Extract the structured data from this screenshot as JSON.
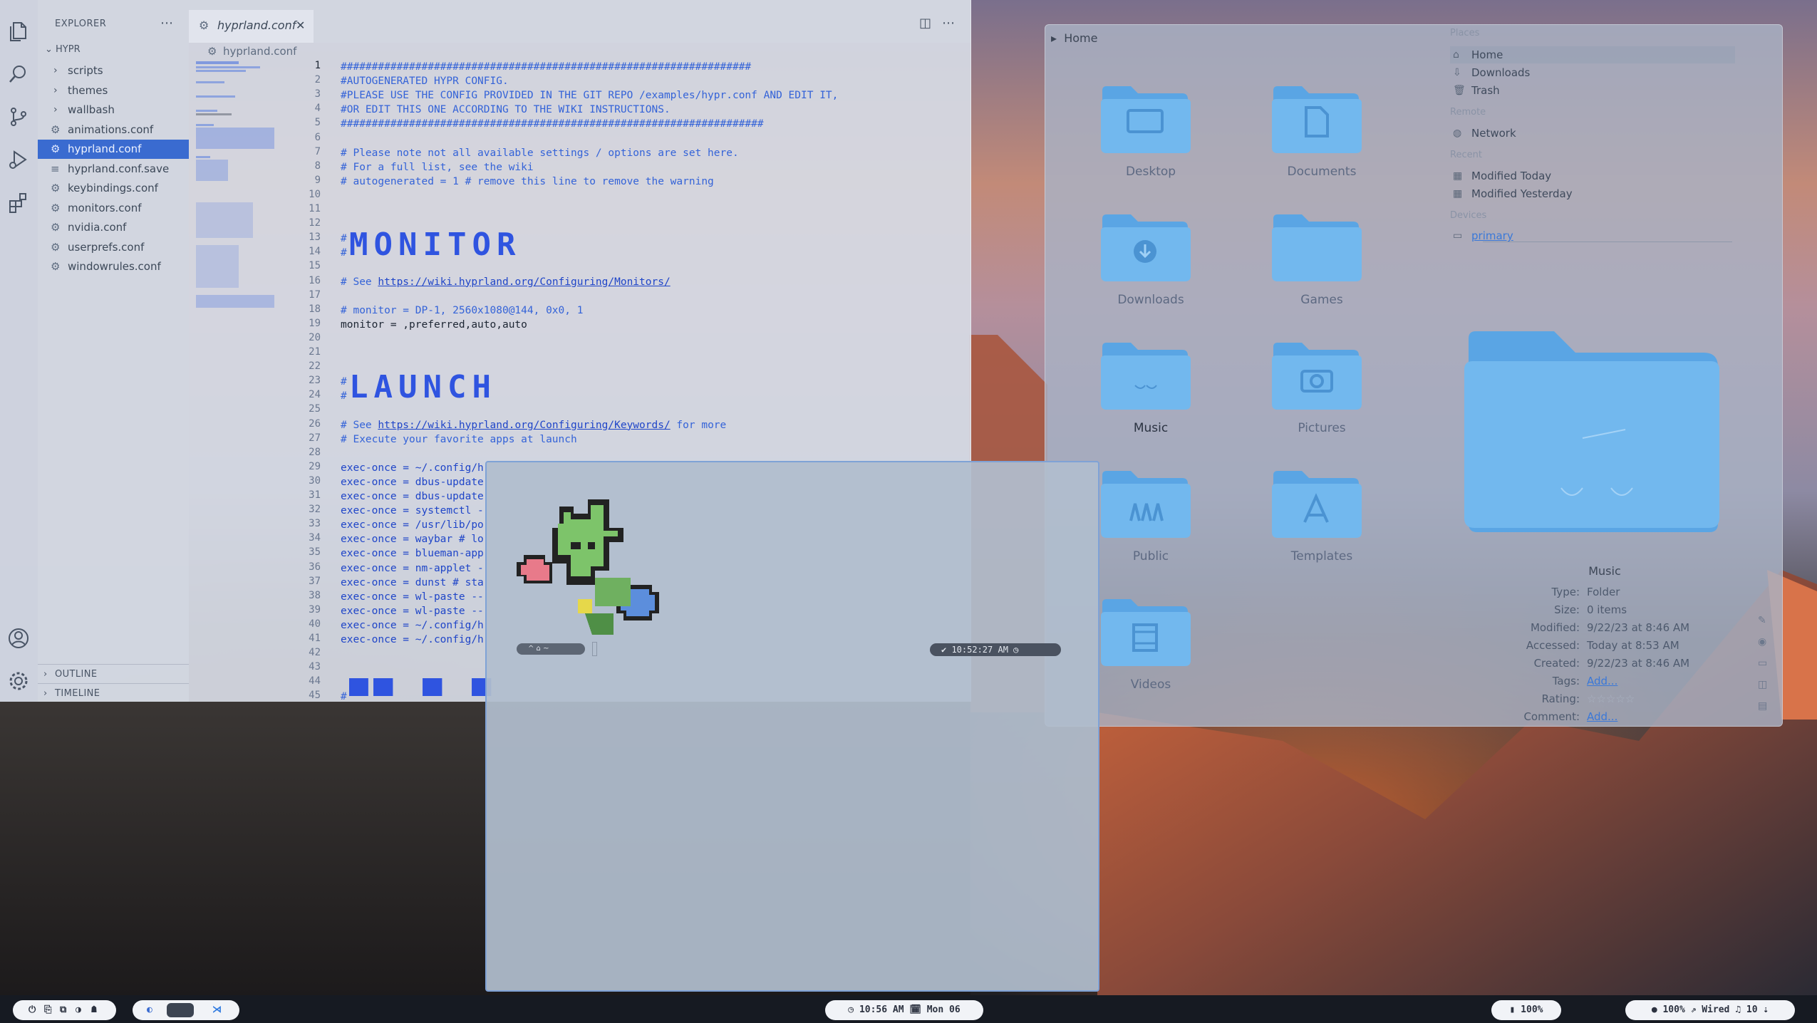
{
  "vscode": {
    "explorer_title": "EXPLORER",
    "root": "HYPR",
    "tree": [
      {
        "label": "scripts",
        "type": "folder"
      },
      {
        "label": "themes",
        "type": "folder"
      },
      {
        "label": "wallbash",
        "type": "folder"
      },
      {
        "label": "animations.conf",
        "type": "file"
      },
      {
        "label": "hyprland.conf",
        "type": "file",
        "selected": true
      },
      {
        "label": "hyprland.conf.save",
        "type": "file"
      },
      {
        "label": "keybindings.conf",
        "type": "file"
      },
      {
        "label": "monitors.conf",
        "type": "file"
      },
      {
        "label": "nvidia.conf",
        "type": "file"
      },
      {
        "label": "userprefs.conf",
        "type": "file"
      },
      {
        "label": "windowrules.conf",
        "type": "file"
      }
    ],
    "outline": "OUTLINE",
    "timeline": "TIMELINE",
    "tab_title": "hyprland.conf",
    "breadcrumb": "hyprland.conf",
    "current_line": 1,
    "code_lines": [
      {
        "n": 1,
        "t": "##################################################################",
        "c": "cmt"
      },
      {
        "n": 2,
        "t": "#AUTOGENERATED HYPR CONFIG.",
        "c": "cmt"
      },
      {
        "n": 3,
        "t": "#PLEASE USE THE CONFIG PROVIDED IN THE GIT REPO /examples/hypr.conf AND EDIT IT,",
        "c": "cmt"
      },
      {
        "n": 4,
        "t": "#OR EDIT THIS ONE ACCORDING TO THE WIKI INSTRUCTIONS.",
        "c": "cmt"
      },
      {
        "n": 5,
        "t": "####################################################################",
        "c": "cmt"
      },
      {
        "n": 6,
        "t": "",
        "c": "cmt"
      },
      {
        "n": 7,
        "t": "# Please note not all available settings / options are set here.",
        "c": "cmt"
      },
      {
        "n": 8,
        "t": "# For a full list, see the wiki",
        "c": "cmt"
      },
      {
        "n": 9,
        "t": "# autogenerated = 1 # remove this line to remove the warning",
        "c": "cmt"
      },
      {
        "n": 10,
        "t": "",
        "c": "cmt"
      },
      {
        "n": 11,
        "t": "",
        "c": "cmt"
      },
      {
        "n": 12,
        "t": "",
        "c": "cmt"
      },
      {
        "n": 13,
        "t": "#",
        "c": "cmt"
      },
      {
        "n": 14,
        "t": "#",
        "c": "cmt"
      },
      {
        "n": 15,
        "t": "",
        "c": "cmt"
      },
      {
        "n": 16,
        "t": "# See ",
        "c": "cmt",
        "url": "https://wiki.hyprland.org/Configuring/Monitors/"
      },
      {
        "n": 17,
        "t": "",
        "c": "cmt"
      },
      {
        "n": 18,
        "t": "# monitor = DP-1, 2560x1080@144, 0x0, 1",
        "c": "cmt"
      },
      {
        "n": 19,
        "t": "monitor = ,preferred,auto,auto",
        "c": "txt"
      },
      {
        "n": 20,
        "t": "",
        "c": "cmt"
      },
      {
        "n": 21,
        "t": "",
        "c": "cmt"
      },
      {
        "n": 22,
        "t": "",
        "c": "cmt"
      },
      {
        "n": 23,
        "t": "#",
        "c": "cmt"
      },
      {
        "n": 24,
        "t": "#",
        "c": "cmt"
      },
      {
        "n": 25,
        "t": "",
        "c": "cmt"
      },
      {
        "n": 26,
        "t": "# See ",
        "c": "cmt",
        "url": "https://wiki.hyprland.org/Configuring/Keywords/",
        "after": " for more"
      },
      {
        "n": 27,
        "t": "# Execute your favorite apps at launch",
        "c": "cmt"
      },
      {
        "n": 28,
        "t": "",
        "c": "cmt"
      },
      {
        "n": 29,
        "t": "exec-once = ~/.config/h",
        "c": "kw"
      },
      {
        "n": 30,
        "t": "exec-once = dbus-update",
        "c": "kw"
      },
      {
        "n": 31,
        "t": "exec-once = dbus-update",
        "c": "kw"
      },
      {
        "n": 32,
        "t": "exec-once = systemctl -",
        "c": "kw"
      },
      {
        "n": 33,
        "t": "exec-once = /usr/lib/po",
        "c": "kw"
      },
      {
        "n": 34,
        "t": "exec-once = waybar # lo",
        "c": "kw"
      },
      {
        "n": 35,
        "t": "exec-once = blueman-app",
        "c": "kw"
      },
      {
        "n": 36,
        "t": "exec-once = nm-applet -",
        "c": "kw"
      },
      {
        "n": 37,
        "t": "exec-once = dunst # sta",
        "c": "kw"
      },
      {
        "n": 38,
        "t": "exec-once = wl-paste --",
        "c": "kw"
      },
      {
        "n": 39,
        "t": "exec-once = wl-paste --",
        "c": "kw"
      },
      {
        "n": 40,
        "t": "exec-once = ~/.config/h",
        "c": "kw"
      },
      {
        "n": 41,
        "t": "exec-once = ~/.config/h",
        "c": "kw"
      },
      {
        "n": 42,
        "t": "",
        "c": "cmt"
      },
      {
        "n": 43,
        "t": "",
        "c": "cmt"
      },
      {
        "n": 44,
        "t": "",
        "c": "cmt"
      },
      {
        "n": 45,
        "t": "#",
        "c": "cmt"
      }
    ],
    "banner_monitor": "MONITOR",
    "banner_launch": "LAUNCH"
  },
  "files": {
    "breadcrumb": "Home",
    "folders": [
      {
        "label": "Desktop",
        "icon": "desktop-icon"
      },
      {
        "label": "Documents",
        "icon": "document-icon"
      },
      {
        "label": "Downloads",
        "icon": "download-icon"
      },
      {
        "label": "Games",
        "icon": "folder-icon"
      },
      {
        "label": "Music",
        "icon": "music-icon",
        "selected": true
      },
      {
        "label": "Pictures",
        "icon": "camera-icon"
      },
      {
        "label": "Public",
        "icon": "people-icon"
      },
      {
        "label": "Templates",
        "icon": "templates-icon"
      },
      {
        "label": "Videos",
        "icon": "film-icon"
      }
    ],
    "places_title": "Places",
    "places": [
      {
        "label": "Home",
        "icon": "home-icon",
        "selected": true
      },
      {
        "label": "Downloads",
        "icon": "download-icon"
      },
      {
        "label": "Trash",
        "icon": "trash-icon"
      }
    ],
    "remote_title": "Remote",
    "remote": [
      {
        "label": "Network",
        "icon": "network-icon"
      }
    ],
    "recent_title": "Recent",
    "recent": [
      {
        "label": "Modified Today",
        "icon": "calendar-icon"
      },
      {
        "label": "Modified Yesterday",
        "icon": "calendar-icon"
      }
    ],
    "devices_title": "Devices",
    "devices": [
      {
        "label": "primary",
        "icon": "drive-icon"
      }
    ],
    "preview": {
      "name": "Music",
      "type_k": "Type:",
      "type_v": "Folder",
      "size_k": "Size:",
      "size_v": "0 items",
      "modified_k": "Modified:",
      "modified_v": "9/22/23 at 8:46 AM",
      "accessed_k": "Accessed:",
      "accessed_v": "Today at 8:53 AM",
      "created_k": "Created:",
      "created_v": "9/22/23 at 8:46 AM",
      "tags_k": "Tags:",
      "tags_v": "Add...",
      "rating_k": "Rating:",
      "rating_v": 0,
      "comment_k": "Comment:",
      "comment_v": "Add..."
    }
  },
  "terminal": {
    "prompt_left": "^  ⌂ ~",
    "prompt_right": "✔  10:52:27 AM ◷"
  },
  "taskbar": {
    "clock": "◷ 10:56 AM  🗓 Mon 06",
    "battery": "▮ 100%",
    "status": "● 100% ⇗ Wired ♫ 10 ⇣",
    "accent": "#f1f3f7",
    "bg": "#161a22"
  },
  "colors": {
    "selection": "#3a6bd0",
    "folder": "#6aaee6",
    "terminal_border": "#7fa2d6"
  }
}
